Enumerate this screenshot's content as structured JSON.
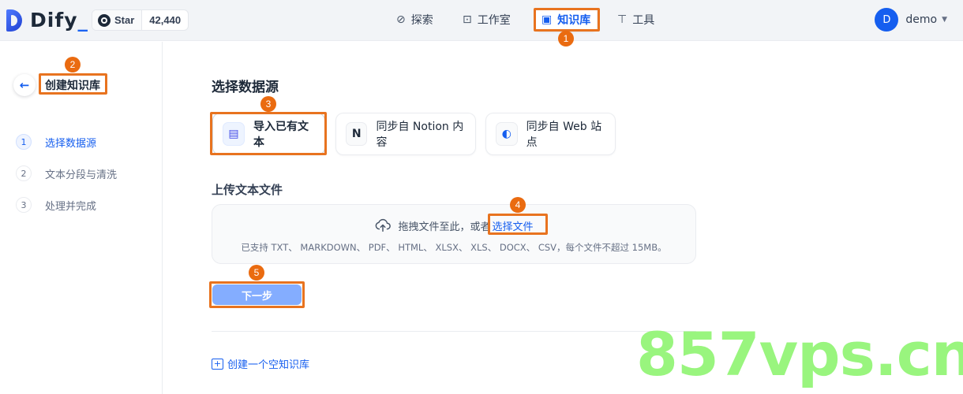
{
  "header": {
    "logo_text": "Dify",
    "logo_suffix": "_",
    "github": {
      "star_label": "Star",
      "star_count": "42,440"
    },
    "nav": [
      {
        "label": "探索",
        "icon": "compass-icon"
      },
      {
        "label": "工作室",
        "icon": "robot-icon"
      },
      {
        "label": "知识库",
        "icon": "book-icon",
        "active": true
      },
      {
        "label": "工具",
        "icon": "hammer-icon"
      }
    ],
    "user": {
      "avatar_letter": "D",
      "name": "demo"
    }
  },
  "sidebar": {
    "title": "创建知识库",
    "steps": [
      {
        "num": "1",
        "label": "选择数据源",
        "state": "active"
      },
      {
        "num": "2",
        "label": "文本分段与清洗",
        "state": "todo"
      },
      {
        "num": "3",
        "label": "处理并完成",
        "state": "todo"
      }
    ]
  },
  "main": {
    "section_title": "选择数据源",
    "sources": [
      {
        "label": "导入已有文本",
        "icon": "file-icon",
        "selected": true
      },
      {
        "label": "同步自 Notion 内容",
        "icon": "notion-icon"
      },
      {
        "label": "同步自 Web 站点",
        "icon": "web-icon"
      }
    ],
    "upload_title": "上传文本文件",
    "upload": {
      "drag_text": "拖拽文件至此，或者",
      "pick_text": "选择文件",
      "support_text": "已支持 TXT、 MARKDOWN、 PDF、 HTML、 XLSX、 XLS、 DOCX、 CSV，每个文件不超过 15MB。"
    },
    "next_button": "下一步",
    "create_empty": "创建一个空知识库"
  },
  "annotations": [
    "1",
    "2",
    "3",
    "4",
    "5"
  ],
  "watermark": "857vps.cn",
  "colors": {
    "accent": "#155eef",
    "annotation": "#e8731f",
    "watermark": "#99f57e"
  }
}
